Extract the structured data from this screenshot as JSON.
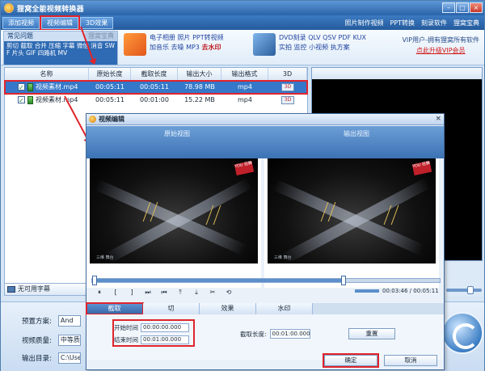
{
  "app": {
    "title": "狸窝全能视频转换器"
  },
  "menu": {
    "add_video": "添加视频",
    "video_edit": "视频编辑",
    "effect_3d": "3D效果",
    "right_links": [
      "照片制作视频",
      "PPT转换",
      "刻录软件",
      "狸窝宝典"
    ]
  },
  "toolbar": {
    "faq": "常见问题",
    "book": "狸窝宝典",
    "tags": "剪切 截取 合并 压缩 字幕 微信 消音 SWF 片头 GIF 四路机 MV",
    "promo1": {
      "line1": "电子相册 照片 PPT转视频",
      "line2a": "加音乐 去噪 MP3 ",
      "line2b": "去水印"
    },
    "promo2": {
      "line1": "DVD刻录 QLV QSV PDF KUX",
      "line2": "实拍 监控 小视频 执方案"
    },
    "vip_line": "VIP用户-拥有狸窝所有软件",
    "vip_link": "点此升级VIP会员",
    "colors": {
      "accent": "#2f6bb4",
      "highlight": "#e0242c"
    }
  },
  "file_list": {
    "columns": [
      "名称",
      "原始长度",
      "截取长度",
      "输出大小",
      "输出格式",
      "3D"
    ],
    "rows": [
      {
        "name": "视频素材.mp4",
        "original": "00:05:11",
        "clip": "00:05:11",
        "size": "78.98 MB",
        "format": "mp4",
        "badge": "3D",
        "selected": true
      },
      {
        "name": "视频素材.mp4",
        "original": "00:05:11",
        "clip": "00:01:00",
        "size": "15.22 MB",
        "format": "mp4",
        "badge": "3D",
        "selected": false
      }
    ]
  },
  "subtitle": {
    "label": "无可用字幕"
  },
  "settings": {
    "preset_label": "预置方案:",
    "preset_value": "And",
    "quality_label": "视频质量:",
    "quality_value": "中等质",
    "output_label": "输出目录:",
    "output_value": "C:\\Use"
  },
  "dialog": {
    "title": "视频编辑",
    "close": "×",
    "original_view": "原始视图",
    "output_view": "输出视图",
    "video_badge": "YOU 狂舞",
    "video_logo": "三维 舞台",
    "controls": [
      "⏸",
      "[",
      "]",
      "⏭",
      "⏮",
      "⤒",
      "⤓",
      "✂",
      "⟲"
    ],
    "timecode": "00:03:46 / 00:05:11",
    "tabs": [
      "截取",
      "切",
      "效果",
      "水印"
    ],
    "start_label": "开始时间",
    "start_value": "00:00:00.000",
    "end_label": "结束时间",
    "end_value": "00:01:00.000",
    "length_label": "截取长度:",
    "length_value": "00:01:00.000",
    "reset": "重置",
    "ok": "确定",
    "cancel": "取消"
  }
}
